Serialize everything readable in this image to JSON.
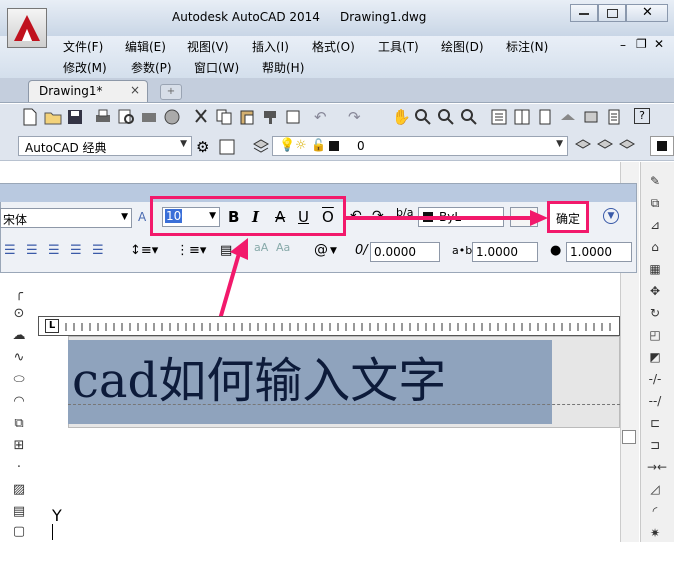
{
  "window": {
    "app_title": "Autodesk AutoCAD 2014",
    "doc_title": "Drawing1.dwg"
  },
  "menu": {
    "row1": [
      "文件(F)",
      "编辑(E)",
      "视图(V)",
      "插入(I)",
      "格式(O)",
      "工具(T)",
      "绘图(D)",
      "标注(N)"
    ],
    "row2": [
      "修改(M)",
      "参数(P)",
      "窗口(W)",
      "帮助(H)"
    ]
  },
  "tabs": {
    "active": "Drawing1*",
    "close": "×"
  },
  "toolbar2": {
    "workspace": "AutoCAD 经典",
    "layer_value": "0"
  },
  "text_format": {
    "font": "宋体",
    "height": "10",
    "bold": "B",
    "italic": "I",
    "strike": "A",
    "underline": "U",
    "overline": "O",
    "color": "ByL",
    "ok_label": "确定",
    "oblique": "0.0000",
    "tracking": "1.0000",
    "width_factor": "1.0000",
    "symbol": "@"
  },
  "drawing": {
    "text": "cad如何输入文字",
    "y_label": "Y"
  },
  "colors": {
    "highlight": "#f2196b",
    "selection": "#8fa3bd"
  }
}
